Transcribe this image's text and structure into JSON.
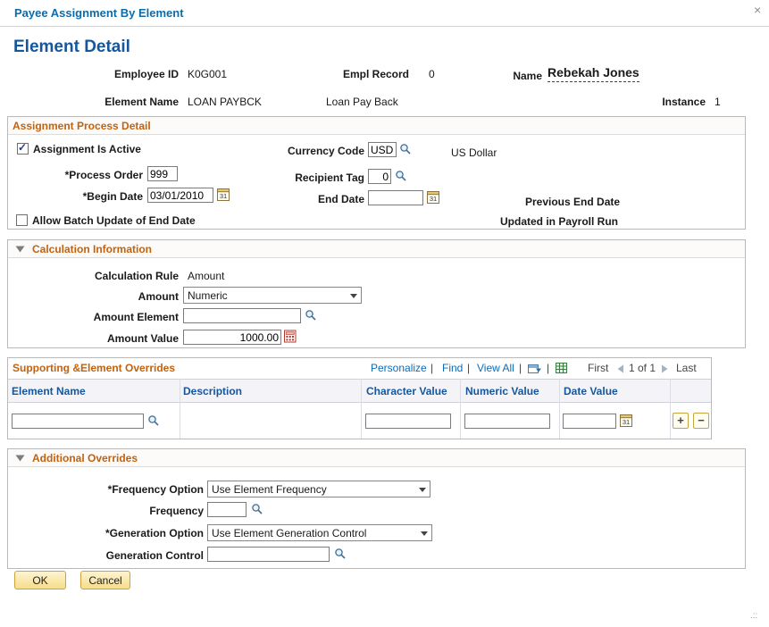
{
  "window": {
    "title": "Payee Assignment By Element",
    "close": "×",
    "resize": ".::"
  },
  "page": {
    "title": "Element Detail"
  },
  "header": {
    "employee_id_label": "Employee ID",
    "employee_id": "K0G001",
    "empl_record_label": "Empl Record",
    "empl_record": "0",
    "name_label": "Name",
    "name": "Rebekah Jones",
    "element_name_label": "Element Name",
    "element_code": "LOAN PAYBCK",
    "element_desc": "Loan Pay Back",
    "instance_label": "Instance",
    "instance": "1"
  },
  "assignment": {
    "title": "Assignment Process Detail",
    "active_label": "Assignment Is Active",
    "currency_label": "Currency Code",
    "currency_value": "USD",
    "currency_desc": "US Dollar",
    "process_order_label": "*Process Order",
    "process_order": "999",
    "recipient_tag_label": "Recipient Tag",
    "recipient_tag": "0",
    "begin_date_label": "*Begin Date",
    "begin_date": "03/01/2010",
    "end_date_label": "End Date",
    "end_date": "",
    "previous_end_date_label": "Previous End Date",
    "allow_batch_label": "Allow Batch Update of End Date",
    "updated_payroll_label": "Updated in Payroll Run"
  },
  "calculation": {
    "title": "Calculation Information",
    "rule_label": "Calculation Rule",
    "rule_value": "Amount",
    "amount_label": "Amount",
    "amount_option": "Numeric",
    "amount_element_label": "Amount Element",
    "amount_element": "",
    "amount_value_label": "Amount Value",
    "amount_value": "1000.00"
  },
  "grid": {
    "title": "Supporting &Element Overrides",
    "personalize": "Personalize",
    "find": "Find",
    "view_all": "View All",
    "sep": "|",
    "first": "First",
    "page": "1 of 1",
    "last": "Last",
    "columns": [
      "Element Name",
      "Description",
      "Character Value",
      "Numeric Value",
      "Date Value"
    ],
    "row": {
      "element_name": "",
      "character_value": "",
      "numeric_value": "",
      "date_value": ""
    }
  },
  "additional": {
    "title": "Additional Overrides",
    "frequency_option_label": "*Frequency Option",
    "frequency_option": "Use Element Frequency",
    "frequency_label": "Frequency",
    "frequency": "",
    "generation_option_label": "*Generation Option",
    "generation_option": "Use Element Generation Control",
    "generation_control_label": "Generation Control",
    "generation_control": ""
  },
  "actions": {
    "ok": "OK",
    "cancel": "Cancel"
  },
  "colors": {
    "section_header": "#c4610c",
    "link": "#0d6bb5",
    "heading": "#15569c"
  }
}
